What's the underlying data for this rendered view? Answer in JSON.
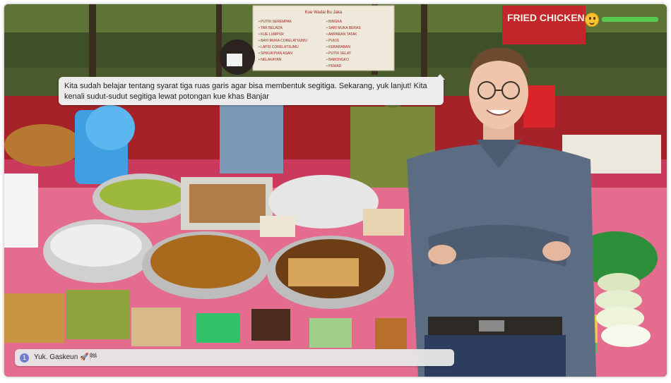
{
  "scene": {
    "stall_sign_left_title": "Kue Wadai Bu Jaka",
    "stall_sign_left_items_a": [
      "PUTRI SEREMPAK",
      "TAR BELADA",
      "KUE LUMPUR",
      "BAYI MUKA CORELATSUMU",
      "LAPIS CORELATSUMU",
      "SPIKUKPIAN ASAN",
      "NELAKAYAN"
    ],
    "stall_sign_left_items_b": [
      "BINGKA",
      "SARI MUKA BERAS",
      "AMPARAN TATAK",
      "PUKIS",
      "KERARABAN",
      "PUTRI SELAT",
      "BARONGKO",
      "PEWAD"
    ],
    "stall_sign_right": "FRIED CHICKEN"
  },
  "dialog": {
    "text": "Kita sudah belajar tentang syarat tiga ruas garis agar bisa membentuk segitiga. Sekarang, yuk lanjut! Kita kenali sudut-sudut segitiga lewat potongan kue khas Banjar"
  },
  "hud": {
    "mood_icon": "happy-face-icon",
    "progress": 1.0,
    "bar_color": "#57c84d"
  },
  "choices": [
    {
      "number": "1",
      "label": "Yuk. Gaskeun 🚀🏁"
    }
  ]
}
